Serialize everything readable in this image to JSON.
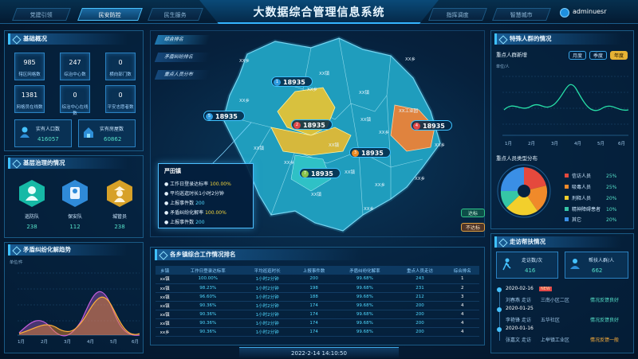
{
  "header": {
    "title": "大数据综合管理信息系统",
    "tabs_left": [
      "党建引领",
      "民安防控",
      "民生服务"
    ],
    "tabs_right": [
      "指挥调度",
      "智慧城市"
    ],
    "active_tab": "民安防控",
    "user": "adminuesr"
  },
  "basic": {
    "title": "基础概况",
    "stats": [
      {
        "value": "985",
        "label": "辖区网格数"
      },
      {
        "value": "247",
        "label": "综治中心数"
      },
      {
        "value": "0",
        "label": "横向部门数"
      },
      {
        "value": "1381",
        "label": "网格员在线数"
      },
      {
        "value": "0",
        "label": "综治中心在线数"
      },
      {
        "value": "0",
        "label": "平安志愿者数"
      }
    ],
    "population_label": "实有人口数",
    "population_value": "416057",
    "housing_label": "实有房屋数",
    "housing_value": "60862"
  },
  "grassroots": {
    "title": "基层治理的情况",
    "items": [
      {
        "label": "巡防队",
        "value": "238",
        "color": "#16b9a6"
      },
      {
        "label": "保安队",
        "value": "112",
        "color": "#2f8ad8"
      },
      {
        "label": "城管员",
        "value": "238",
        "color": "#d7a128"
      }
    ]
  },
  "conflict": {
    "title": "矛盾纠纷化解趋势",
    "unit": "单位/件",
    "x": [
      "1月",
      "2月",
      "3月",
      "4月",
      "5月",
      "6月"
    ]
  },
  "map": {
    "side_tabs": [
      "综合排名",
      "矛盾纠纷排名",
      "重点人员分布"
    ],
    "markers": [
      {
        "num": "1",
        "value": "18935",
        "color": "#2e9be0"
      },
      {
        "num": "2",
        "value": "18935",
        "color": "#e04848"
      },
      {
        "num": "3",
        "value": "18935",
        "color": "#ef8a22"
      },
      {
        "num": "4",
        "value": "18935",
        "color": "#e04848"
      },
      {
        "num": "5",
        "value": "18935",
        "color": "#2e9be0"
      },
      {
        "num": "6",
        "value": "18935",
        "color": "#2e9be0"
      },
      {
        "num": "7",
        "value": "18935",
        "color": "#8bc34a"
      }
    ],
    "labels": [
      "XX乡",
      "XX镇",
      "XX乡",
      "XX乡",
      "XX镇",
      "XX乡",
      "XX镇",
      "XX乡",
      "XX镇",
      "XX镇",
      "XX乡",
      "XX镇",
      "XX乡",
      "XX乡",
      "XX镇",
      "XX乡",
      "XX工业园",
      "XX乡"
    ],
    "popup": {
      "title": "严田镇",
      "rows": [
        {
          "label": "工作日登录达标率",
          "value": "100.00%"
        },
        {
          "label": "平均巡逛时长1小时2分钟",
          "value": ""
        },
        {
          "label": "上报事件数",
          "value": "200"
        },
        {
          "label": "矛盾纠纷化解率",
          "value": "100.00%"
        },
        {
          "label": "上报事件数",
          "value": "200"
        }
      ]
    },
    "legend_ok": "达标",
    "legend_no": "不达标"
  },
  "ranking": {
    "title": "各乡镇综合工作情况排名",
    "headers": [
      "乡镇",
      "工作日登录达标率",
      "平均巡逛时长",
      "上报事件数",
      "矛盾纠纷化解率",
      "重点人员走访",
      "综合排名"
    ],
    "rows": [
      [
        "xx镇",
        "100.00%",
        "1小时2分钟",
        "200",
        "99.68%",
        "243",
        "1"
      ],
      [
        "xx镇",
        "98.23%",
        "1小时2分钟",
        "198",
        "99.68%",
        "231",
        "2"
      ],
      [
        "xx镇",
        "96.60%",
        "1小时2分钟",
        "188",
        "99.68%",
        "212",
        "3"
      ],
      [
        "xx镇",
        "90.36%",
        "1小时2分钟",
        "174",
        "99.68%",
        "200",
        "4"
      ],
      [
        "xx镇",
        "90.36%",
        "1小时2分钟",
        "174",
        "99.68%",
        "200",
        "4"
      ],
      [
        "xx镇",
        "90.36%",
        "1小时2分钟",
        "174",
        "99.68%",
        "200",
        "4"
      ],
      [
        "xx乡",
        "90.36%",
        "1小时2分钟",
        "174",
        "99.68%",
        "200",
        "4"
      ]
    ],
    "datetime": "2022-2-14  14:10:50"
  },
  "special": {
    "title": "特殊人群的情况",
    "sub_new": "重点人群新增",
    "unit": "单位/人",
    "period_tabs": [
      "月度",
      "季度",
      "年度"
    ],
    "x": [
      "1月",
      "2月",
      "3月",
      "4月",
      "5月",
      "6月"
    ],
    "sub_dist": "重点人员类型分布",
    "dist": [
      {
        "label": "信访人员",
        "pct": "25%",
        "color": "#e5493d"
      },
      {
        "label": "吸毒人员",
        "pct": "25%",
        "color": "#f08a2a"
      },
      {
        "label": "刑释人员",
        "pct": "20%",
        "color": "#f2cf2c"
      },
      {
        "label": "精神障碍患者",
        "pct": "10%",
        "color": "#35c6a6"
      },
      {
        "label": "其它",
        "pct": "20%",
        "color": "#3a8fe6"
      }
    ]
  },
  "visit": {
    "title": "走访帮扶情况",
    "visit_label": "走访数/次",
    "visit_value": "416",
    "help_label": "帮扶人群/人",
    "help_value": "662",
    "events": [
      {
        "date": "2020-02-16",
        "tag": "NEW",
        "name": "刘春燕",
        "type": "走访",
        "place": "三南小区二区",
        "status": "情况反馈良好"
      },
      {
        "date": "2020-01-25",
        "tag": "",
        "name": "李艳锋",
        "type": "走访",
        "place": "五华社区",
        "status": "情况反馈良好"
      },
      {
        "date": "2020-01-16",
        "tag": "",
        "name": "张嘉文",
        "type": "走访",
        "place": "上举镇工业区",
        "status": "情况反馈一般"
      }
    ]
  }
}
